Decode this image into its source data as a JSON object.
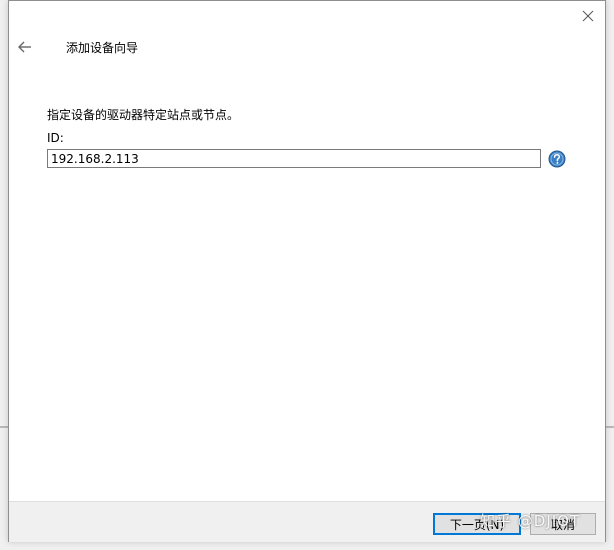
{
  "dialog": {
    "title": "添加设备向导",
    "instruction": "指定设备的驱动器特定站点或节点。",
    "id_label": "ID:",
    "id_value": "192.168.2.113"
  },
  "icons": {
    "back": "arrow-left-icon",
    "close": "close-icon",
    "help": "help-icon"
  },
  "footer": {
    "next_label": "下一页(N)",
    "cancel_label": "取消"
  },
  "watermark": "知乎 @DJIOT",
  "colors": {
    "accent": "#0078d7",
    "help_icon": "#3a7fc4",
    "footer_bg": "#f0f0f0"
  }
}
